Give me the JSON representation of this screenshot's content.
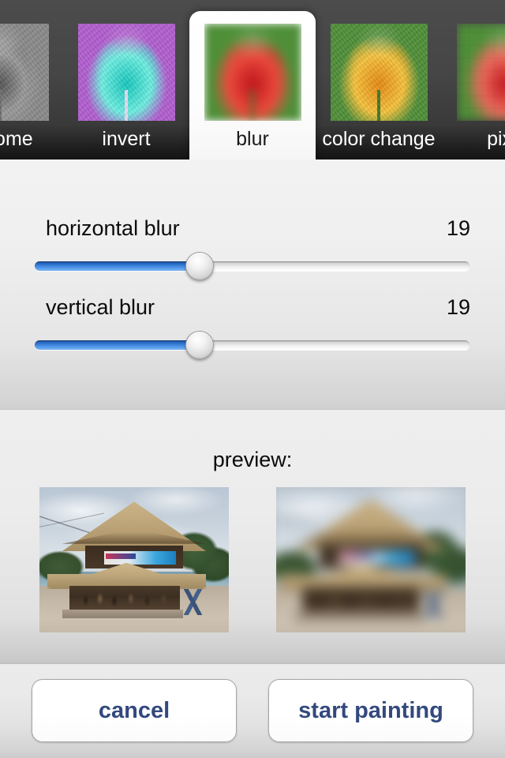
{
  "tabbar": {
    "selected_index": 2,
    "tabs": [
      {
        "label": "chrome",
        "icon": "monochrome-tulip-thumbnail",
        "effect": "monochrome"
      },
      {
        "label": "invert",
        "icon": "inverted-tulip-thumbnail",
        "effect": "invert"
      },
      {
        "label": "blur",
        "icon": "blurred-tulip-thumbnail",
        "effect": "blur"
      },
      {
        "label": "color change",
        "icon": "color-changed-tulip-thumbnail",
        "effect": "color-change"
      },
      {
        "label": "pixe",
        "icon": "pixelated-tulip-thumbnail",
        "effect": "pixelate"
      }
    ]
  },
  "sliders": [
    {
      "name": "horizontal blur",
      "value": "19",
      "percent": 38
    },
    {
      "name": "vertical blur",
      "value": "19",
      "percent": 38
    }
  ],
  "preview": {
    "title": "preview:",
    "original_alt": "beach-hut-original-photo",
    "processed_alt": "beach-hut-blurred-photo"
  },
  "buttons": {
    "cancel_label": "cancel",
    "start_label": "start painting"
  },
  "colors": {
    "accent_blue": "#2c6fc9",
    "button_text": "#33497e",
    "tabbar_dark": "#464646",
    "panel_light": "#f0f0f0"
  }
}
